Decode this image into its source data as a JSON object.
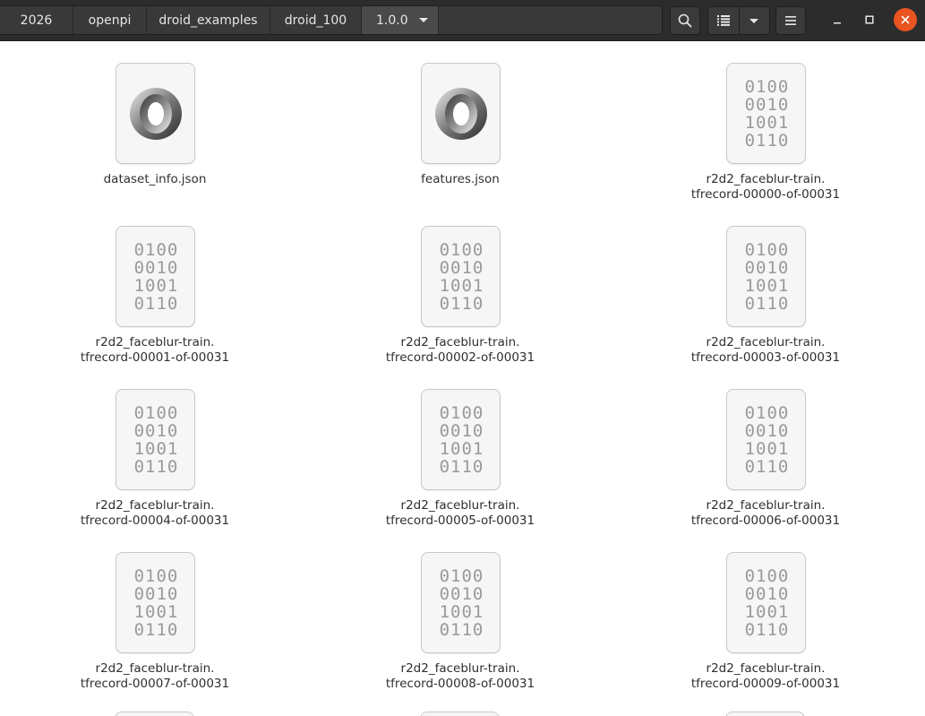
{
  "breadcrumbs": [
    "2026",
    "openpi",
    "droid_examples",
    "droid_100"
  ],
  "current_folder": "1.0.0",
  "icons": {
    "search": "search-icon",
    "view_list": "list-view-icon",
    "view_options": "chevron-down-icon",
    "menu": "hamburger-menu-icon",
    "minimize": "minimize-icon",
    "maximize": "maximize-icon",
    "close": "close-icon"
  },
  "colors": {
    "close_button": "#e95420",
    "header": "#2c2c2c"
  },
  "binary_glyph": [
    "0100",
    "0010",
    "1001",
    "0110"
  ],
  "files": [
    {
      "line1": "dataset_info.json",
      "line2": "",
      "type": "json"
    },
    {
      "line1": "features.json",
      "line2": "",
      "type": "json"
    },
    {
      "line1": "r2d2_faceblur-train.",
      "line2": "tfrecord-00000-of-00031",
      "type": "binary"
    },
    {
      "line1": "r2d2_faceblur-train.",
      "line2": "tfrecord-00001-of-00031",
      "type": "binary"
    },
    {
      "line1": "r2d2_faceblur-train.",
      "line2": "tfrecord-00002-of-00031",
      "type": "binary"
    },
    {
      "line1": "r2d2_faceblur-train.",
      "line2": "tfrecord-00003-of-00031",
      "type": "binary"
    },
    {
      "line1": "r2d2_faceblur-train.",
      "line2": "tfrecord-00004-of-00031",
      "type": "binary"
    },
    {
      "line1": "r2d2_faceblur-train.",
      "line2": "tfrecord-00005-of-00031",
      "type": "binary"
    },
    {
      "line1": "r2d2_faceblur-train.",
      "line2": "tfrecord-00006-of-00031",
      "type": "binary"
    },
    {
      "line1": "r2d2_faceblur-train.",
      "line2": "tfrecord-00007-of-00031",
      "type": "binary"
    },
    {
      "line1": "r2d2_faceblur-train.",
      "line2": "tfrecord-00008-of-00031",
      "type": "binary"
    },
    {
      "line1": "r2d2_faceblur-train.",
      "line2": "tfrecord-00009-of-00031",
      "type": "binary"
    }
  ]
}
